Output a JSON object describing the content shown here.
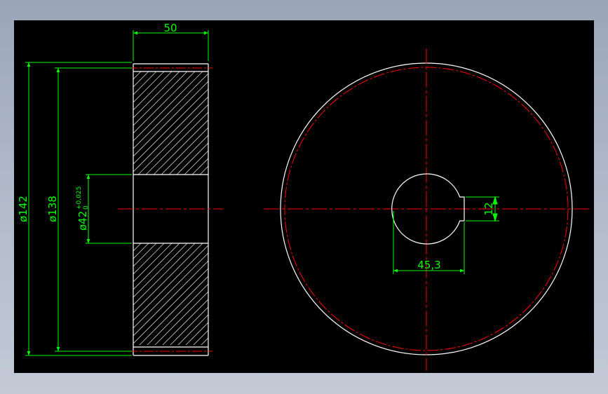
{
  "drawing": {
    "background_color": "#000000",
    "window_color": "#a5b0c1",
    "colors": {
      "outline": "#ffffff",
      "dimension": "#00ff00",
      "centerline": "#ff0000",
      "hatch": "#c8c8c8"
    },
    "dimensions": {
      "face_width": "50",
      "outer_diameter": "ø142",
      "pitch_diameter": "ø138",
      "bore_diameter": "ø42",
      "bore_tol_upper": "+0,025",
      "bore_tol_lower": "0",
      "keyway_depth": "45,3",
      "keyway_width": "12"
    }
  }
}
